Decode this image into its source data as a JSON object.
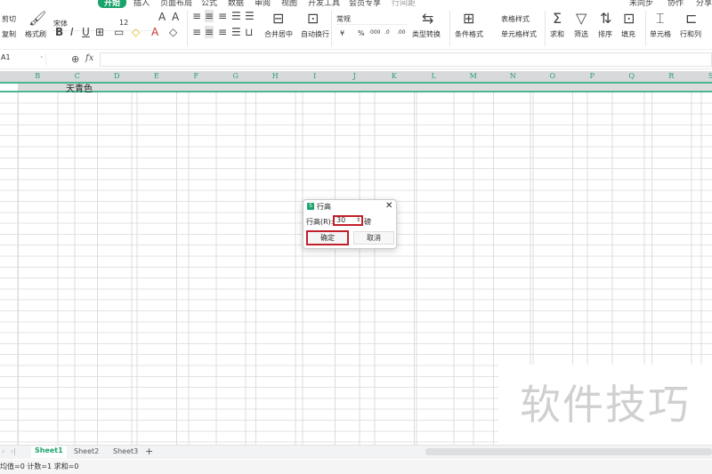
{
  "menu": {
    "items": [
      "开始",
      "插入",
      "页面布局",
      "公式",
      "数据",
      "审阅",
      "视图",
      "开发工具",
      "会员专享"
    ],
    "search": "行间距",
    "sync": "未同步",
    "collab": "协作",
    "share": "分享"
  },
  "ribbon": {
    "cut": "剪切",
    "copy": "复制",
    "format_painter": "格式刷",
    "font_name": "宋体",
    "font_size": "12",
    "bold": "B",
    "italic": "I",
    "underline": "U",
    "merge": "合并居中",
    "wrap": "自动换行",
    "number_format": "常规",
    "currency": "¥",
    "percent": "%",
    "type_convert": "类型转换",
    "cond_format": "条件格式",
    "table_style": "表格样式",
    "cell_style": "单元格样式",
    "sum": "求和",
    "filter": "筛选",
    "sort": "排序",
    "fill": "填充",
    "cell": "单元格",
    "rowcol": "行和列"
  },
  "formula": {
    "namebox": "A1",
    "fx": "fx",
    "value": ""
  },
  "grid": {
    "columns": [
      "B",
      "C",
      "D",
      "E",
      "F",
      "G",
      "H",
      "I",
      "J",
      "K",
      "L",
      "M",
      "N",
      "O",
      "P",
      "Q",
      "R",
      "S"
    ],
    "cell_c1": "天青色"
  },
  "dialog": {
    "title": "行高",
    "label": "行高(R):",
    "value": "30",
    "unit": "磅",
    "ok": "确定",
    "cancel": "取消"
  },
  "sheets": {
    "tabs": [
      "Sheet1",
      "Sheet2",
      "Sheet3"
    ],
    "add": "+"
  },
  "status": {
    "text": "均值=0  计数=1  求和=0"
  },
  "watermark": "软件技巧"
}
